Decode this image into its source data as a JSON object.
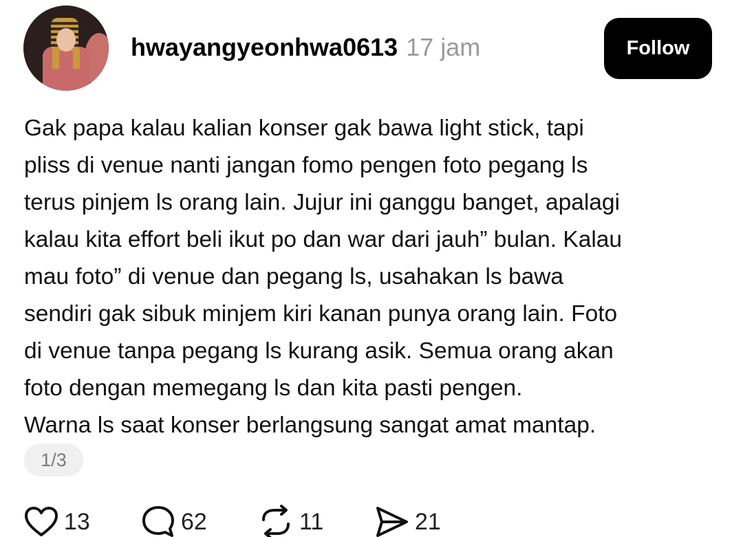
{
  "post": {
    "username": "hwayangyeonhwa0613",
    "time": "17 jam",
    "follow_label": "Follow",
    "text_lines": [
      "Gak papa kalau kalian konser gak bawa light stick, tapi",
      "pliss di venue nanti jangan fomo pengen foto pegang ls",
      "terus pinjem ls orang lain. Jujur ini ganggu banget, apalagi",
      "kalau kita effort beli ikut po dan war dari jauh” bulan. Kalau",
      "mau foto” di venue dan pegang ls, usahakan ls bawa",
      "sendiri gak sibuk minjem kiri kanan punya orang lain. Foto",
      "di venue tanpa pegang ls kurang asik. Semua orang akan",
      "foto dengan memegang ls dan kita pasti pengen.",
      "Warna ls saat konser berlangsung sangat amat mantap."
    ],
    "page_indicator": "1/3"
  },
  "actions": {
    "like": {
      "icon": "heart-icon",
      "count": "13"
    },
    "comment": {
      "icon": "comment-icon",
      "count": "62"
    },
    "repost": {
      "icon": "repost-icon",
      "count": "11"
    },
    "share": {
      "icon": "send-icon",
      "count": "21"
    }
  },
  "colors": {
    "follow_button_bg": "#000000",
    "follow_button_text": "#ffffff",
    "timestamp": "#9a9a9a",
    "page_indicator_bg": "#f0f0f0"
  }
}
